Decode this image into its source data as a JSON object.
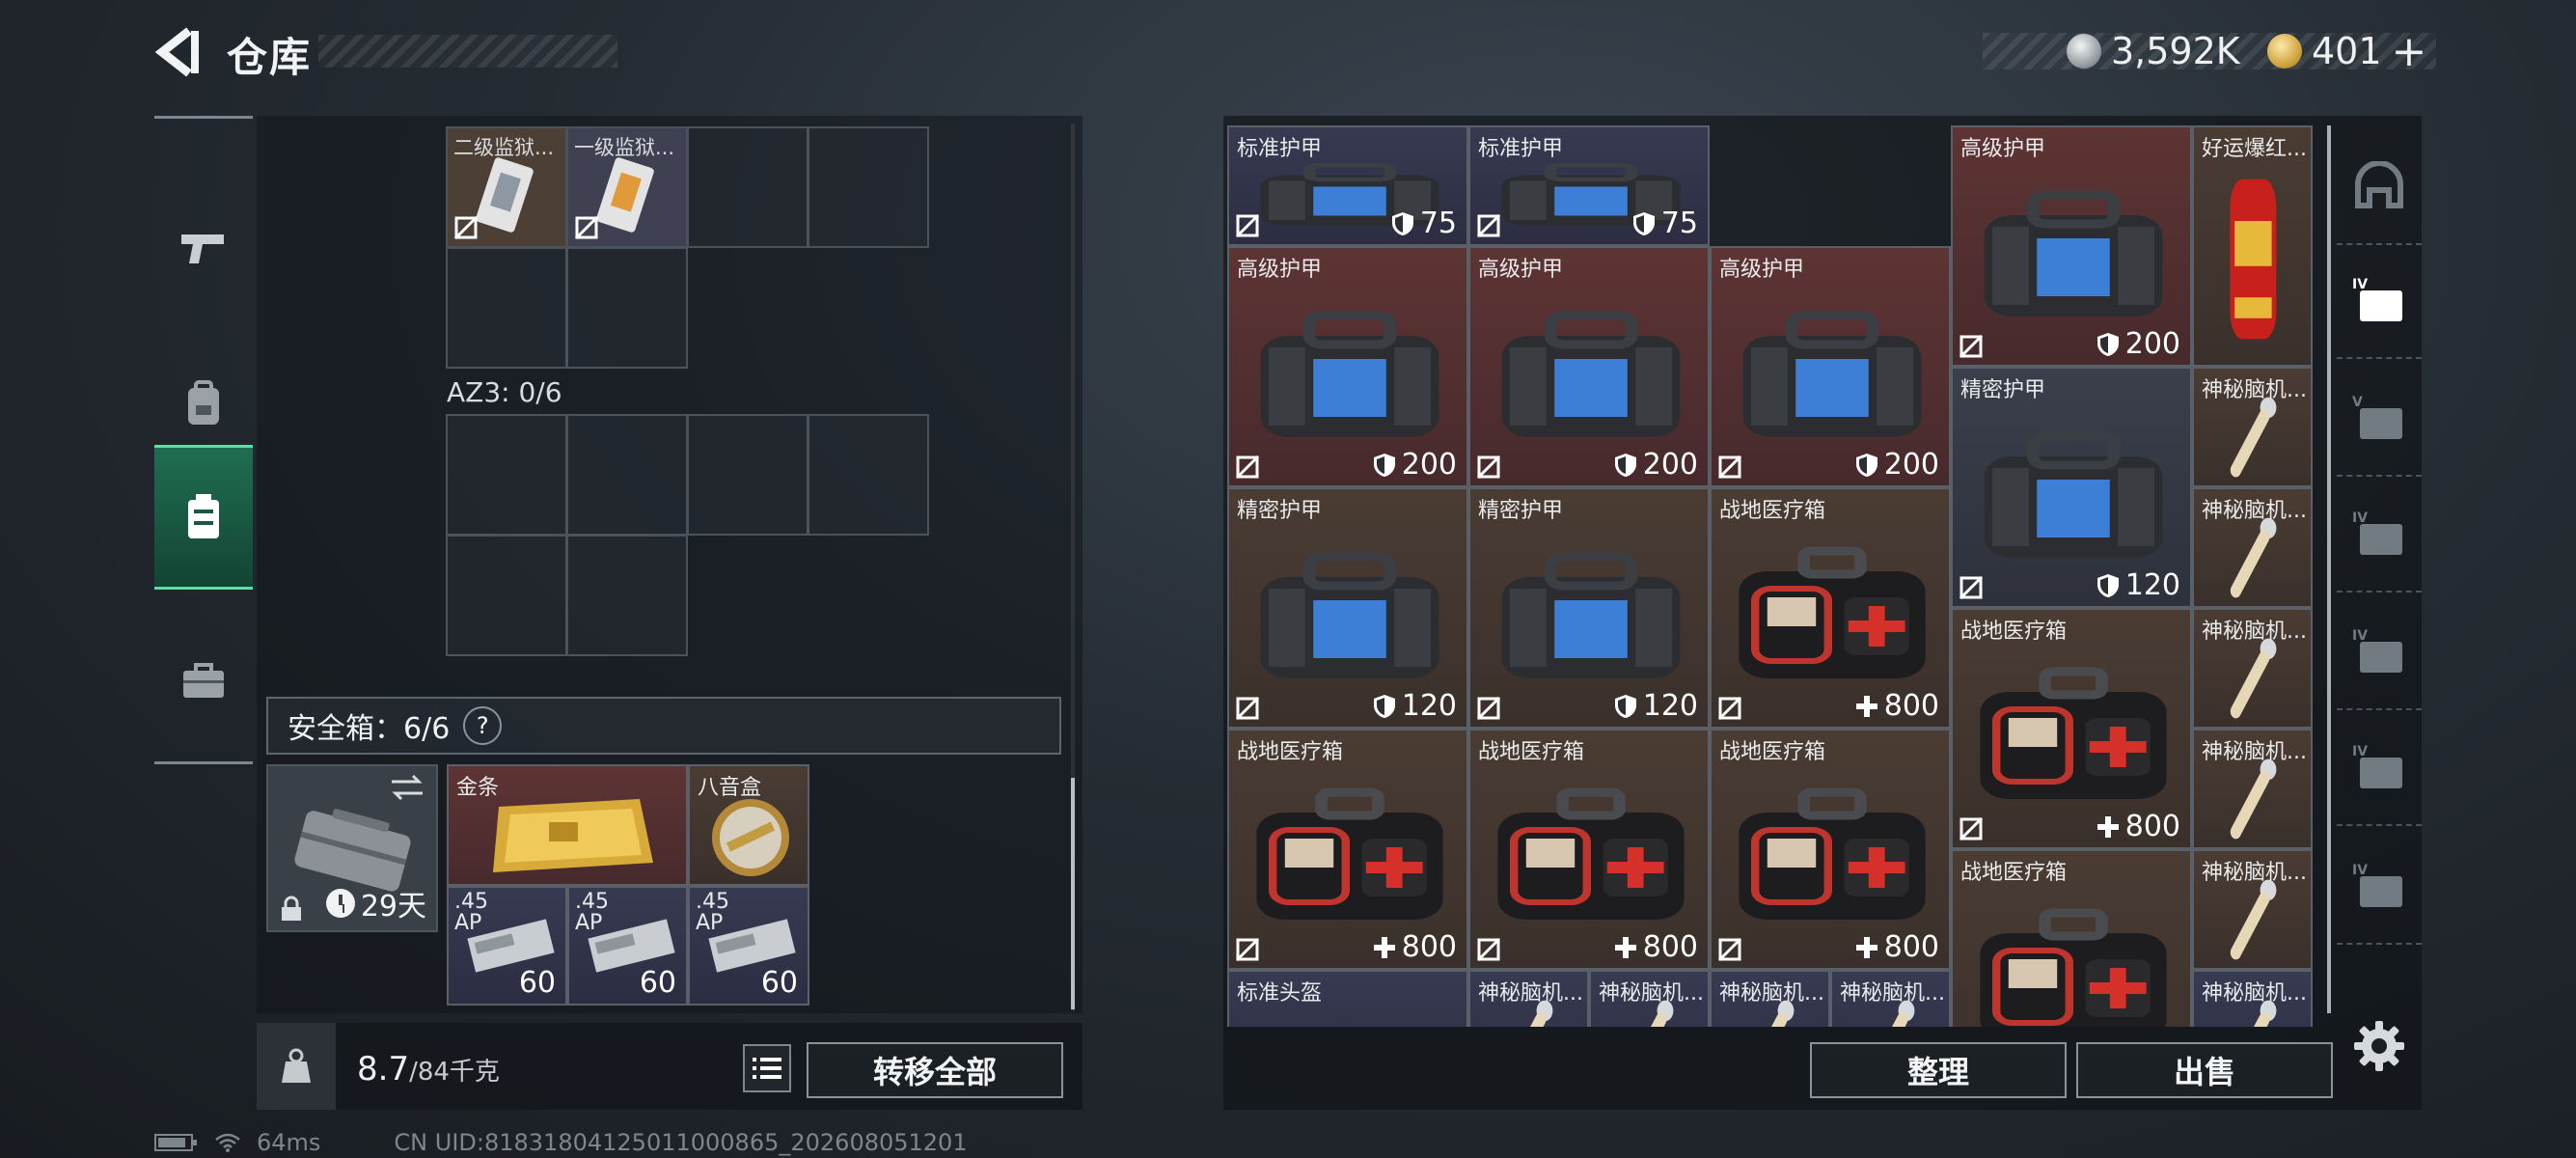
{
  "header": {
    "title": "仓库",
    "currency": [
      {
        "icon": "silver-coin-icon",
        "value": "3,592K"
      },
      {
        "icon": "gold-coin-icon",
        "value": "401"
      },
      {
        "icon": "plus-icon",
        "value": "+"
      }
    ]
  },
  "rail": {
    "items": [
      {
        "name": "weapons",
        "icon": "pistol-icon",
        "active": false
      },
      {
        "name": "backpack",
        "icon": "backpack-icon",
        "active": false
      },
      {
        "name": "vest",
        "icon": "vest-icon",
        "active": true
      },
      {
        "name": "case",
        "icon": "briefcase-icon",
        "active": false
      }
    ]
  },
  "container": {
    "top_items": [
      {
        "label": "二级监狱..."
      },
      {
        "label": "一级监狱..."
      }
    ],
    "az3_label": "AZ3: 0/6",
    "safebox_label": "安全箱：6/6",
    "safebox_help": "?",
    "case_days": "29天",
    "safebox_items": [
      {
        "label": "金条",
        "value": ""
      },
      {
        "label": "八音盒",
        "value": ""
      },
      {
        "label": ".45\nAP",
        "value": "60"
      },
      {
        "label": ".45\nAP",
        "value": "60"
      },
      {
        "label": ".45\nAP",
        "value": "60"
      }
    ]
  },
  "footer_left": {
    "weight_current": "8.7",
    "weight_max": "/84千克",
    "transfer_label": "转移全部"
  },
  "stash": {
    "items": [
      {
        "label": "标准护甲",
        "value": "75",
        "type": "armor",
        "stat": "shield"
      },
      {
        "label": "标准护甲",
        "value": "75",
        "type": "armor",
        "stat": "shield"
      },
      {
        "label": "高级护甲",
        "value": "200",
        "type": "armor",
        "stat": "shield"
      },
      {
        "label": "好运爆红...",
        "value": "",
        "type": "firecracker",
        "stat": ""
      },
      {
        "label": "高级护甲",
        "value": "200",
        "type": "armor",
        "stat": "shield"
      },
      {
        "label": "高级护甲",
        "value": "200",
        "type": "armor",
        "stat": "shield"
      },
      {
        "label": "高级护甲",
        "value": "200",
        "type": "armor",
        "stat": "shield"
      },
      {
        "label": "精密护甲",
        "value": "120",
        "type": "armor",
        "stat": "shield"
      },
      {
        "label": "神秘脑机...",
        "value": "",
        "type": "chip",
        "stat": ""
      },
      {
        "label": "神秘脑机...",
        "value": "",
        "type": "chip",
        "stat": ""
      },
      {
        "label": "精密护甲",
        "value": "120",
        "type": "armor",
        "stat": "shield"
      },
      {
        "label": "精密护甲",
        "value": "120",
        "type": "armor",
        "stat": "shield"
      },
      {
        "label": "战地医疗箱",
        "value": "800",
        "type": "medkit",
        "stat": "plus"
      },
      {
        "label": "战地医疗箱",
        "value": "800",
        "type": "medkit",
        "stat": "plus"
      },
      {
        "label": "神秘脑机...",
        "value": "",
        "type": "chip",
        "stat": ""
      },
      {
        "label": "神秘脑机...",
        "value": "",
        "type": "chip",
        "stat": ""
      },
      {
        "label": "战地医疗箱",
        "value": "800",
        "type": "medkit",
        "stat": "plus"
      },
      {
        "label": "战地医疗箱",
        "value": "800",
        "type": "medkit",
        "stat": "plus"
      },
      {
        "label": "战地医疗箱",
        "value": "800",
        "type": "medkit",
        "stat": "plus"
      },
      {
        "label": "战地医疗箱",
        "value": "",
        "type": "medkit",
        "stat": ""
      },
      {
        "label": "神秘脑机...",
        "value": "",
        "type": "chip",
        "stat": ""
      },
      {
        "label": "标准头盔",
        "value": "",
        "type": "helmet",
        "stat": ""
      },
      {
        "label": "神秘脑机...",
        "value": "",
        "type": "chip",
        "stat": ""
      },
      {
        "label": "神秘脑机...",
        "value": "",
        "type": "chip",
        "stat": ""
      },
      {
        "label": "神秘脑机...",
        "value": "",
        "type": "chip",
        "stat": ""
      },
      {
        "label": "神秘脑机...",
        "value": "",
        "type": "chip",
        "stat": ""
      },
      {
        "label": "神秘脑机...",
        "value": "",
        "type": "chip",
        "stat": ""
      }
    ],
    "sort_label": "整理",
    "sell_label": "出售"
  },
  "filters": [
    {
      "icon": "helmet-filter-icon",
      "label": ""
    },
    {
      "icon": "medkit-filter-icon",
      "label": "IV"
    },
    {
      "icon": "camera-filter-icon",
      "label": "V"
    },
    {
      "icon": "vehicle-filter-icon",
      "label": "IV"
    },
    {
      "icon": "medkit-filter-icon",
      "label": "IV"
    },
    {
      "icon": "folder-filter-icon",
      "label": "IV"
    },
    {
      "icon": "container-filter-icon",
      "label": "IV"
    }
  ],
  "status": {
    "ping": "64ms",
    "uid": "CN UID:8183180412501100086​5_202608051201"
  }
}
